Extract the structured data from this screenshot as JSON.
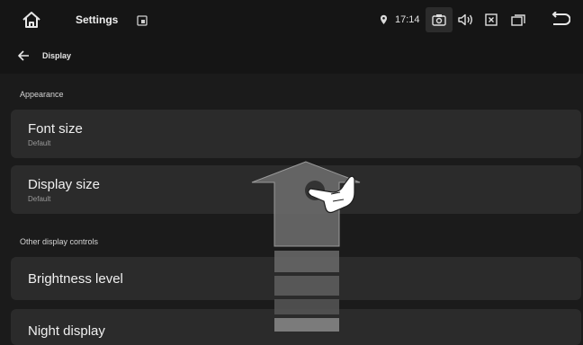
{
  "status_bar": {
    "app_title": "Settings",
    "time": "17:14",
    "icons": [
      "home-icon",
      "notification-icon",
      "location-icon",
      "screenshot-icon",
      "volume-icon",
      "close-window-icon",
      "multitask-icon",
      "back-icon"
    ]
  },
  "app_bar": {
    "title": "Display",
    "back_icon": "arrow-left-icon"
  },
  "sections": [
    {
      "header": "Appearance",
      "items": [
        {
          "title": "Font size",
          "subtitle": "Default"
        },
        {
          "title": "Display size",
          "subtitle": "Default"
        }
      ]
    },
    {
      "header": "Other display controls",
      "items": [
        {
          "title": "Brightness level"
        },
        {
          "title": "Night display"
        }
      ]
    }
  ],
  "overlay": {
    "gesture": "swipe-up",
    "icons": [
      "swipe-up-arrow-icon",
      "pointing-hand-icon"
    ]
  },
  "colors": {
    "background": "#1b1b1b",
    "bar": "#151515",
    "card": "#2b2b2b",
    "text": "#f0f0f0",
    "subtext": "#9a9a9a"
  }
}
